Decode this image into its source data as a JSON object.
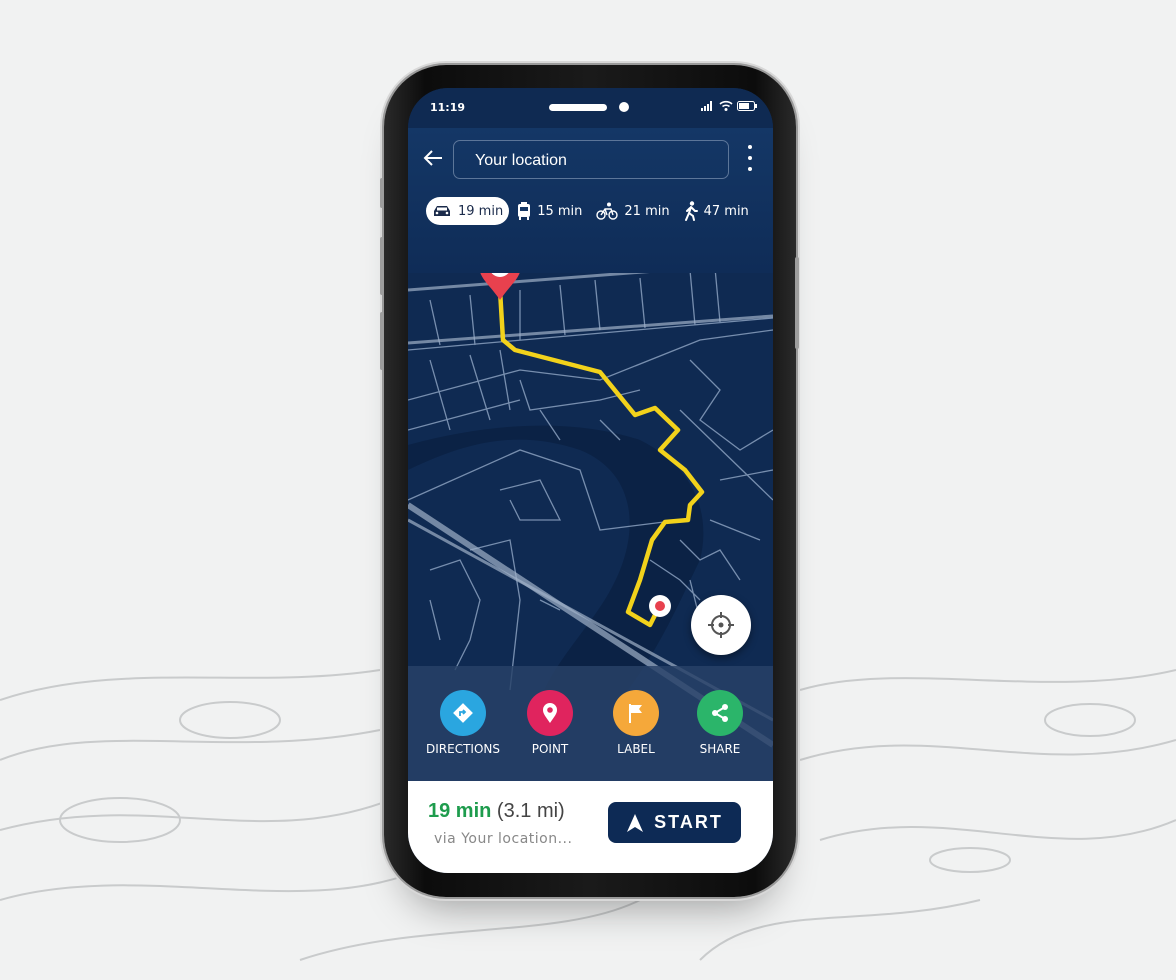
{
  "status_bar": {
    "time": "11:19"
  },
  "search": {
    "value": "Your location"
  },
  "travel_modes": [
    {
      "mode": "car",
      "icon": "car-icon",
      "label": "19 min",
      "selected": true
    },
    {
      "mode": "transit",
      "icon": "bus-icon",
      "label": "15 min",
      "selected": false
    },
    {
      "mode": "bike",
      "icon": "bicycle-icon",
      "label": "21 min",
      "selected": false
    },
    {
      "mode": "walk",
      "icon": "walking-icon",
      "label": "47 min",
      "selected": false
    }
  ],
  "actions": [
    {
      "label": "DIRECTIONS",
      "icon": "directions-icon",
      "color": "#2aa6e0"
    },
    {
      "label": "POINT",
      "icon": "map-pin-icon",
      "color": "#e0245e"
    },
    {
      "label": "LABEL",
      "icon": "flag-icon",
      "color": "#f5a83a"
    },
    {
      "label": "SHARE",
      "icon": "share-icon",
      "color": "#2bb56a"
    }
  ],
  "summary": {
    "duration": "19 min",
    "distance": "(3.1 mi)",
    "via": "via Your location..."
  },
  "start_button": {
    "label": "START"
  },
  "colors": {
    "map_bg": "#0f2a52",
    "route": "#f2d21b",
    "accent_green": "#1e9c4d",
    "pin": "#e8414e"
  }
}
